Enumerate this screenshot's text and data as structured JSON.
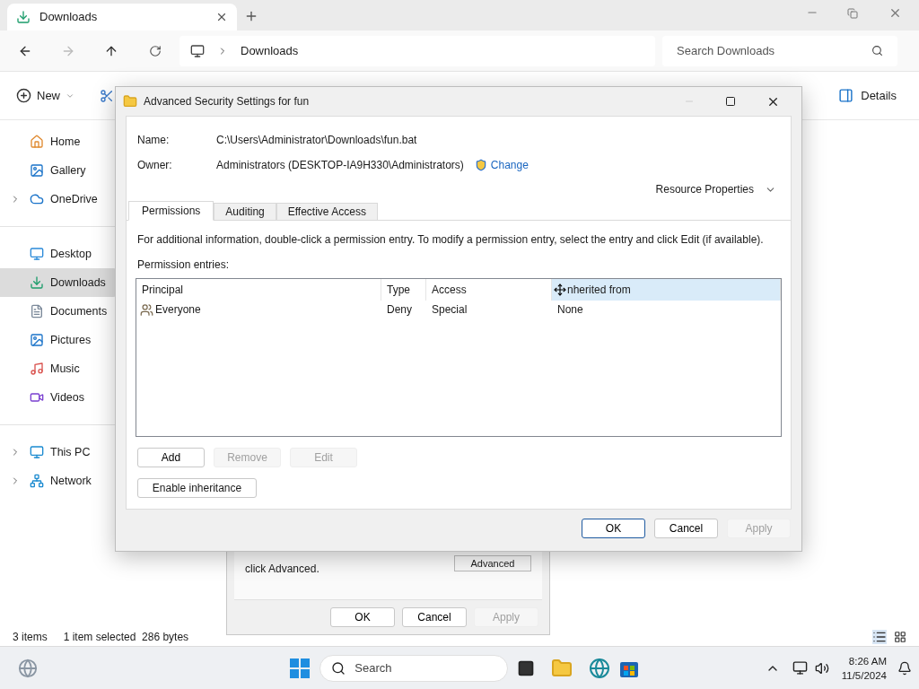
{
  "explorer": {
    "tab_title": "Downloads",
    "path": [
      "Downloads"
    ],
    "search": {
      "placeholder": "Search Downloads"
    },
    "new_label": "New",
    "details_label": "Details",
    "sidebar": [
      [
        {
          "label": "Home",
          "selected": false,
          "expandable": false
        },
        {
          "label": "Gallery",
          "selected": false,
          "expandable": false
        },
        {
          "label": "OneDrive",
          "selected": false,
          "expandable": true
        }
      ],
      [
        {
          "label": "Desktop",
          "selected": false,
          "expandable": false
        },
        {
          "label": "Downloads",
          "selected": true,
          "expandable": false
        },
        {
          "label": "Documents",
          "selected": false,
          "expandable": false
        },
        {
          "label": "Pictures",
          "selected": false,
          "expandable": false
        },
        {
          "label": "Music",
          "selected": false,
          "expandable": false
        },
        {
          "label": "Videos",
          "selected": false,
          "expandable": false
        }
      ],
      [
        {
          "label": "This PC",
          "selected": false,
          "expandable": true
        },
        {
          "label": "Network",
          "selected": false,
          "expandable": true
        }
      ]
    ],
    "status": {
      "count": "3 items",
      "selection": "1 item selected  286 bytes"
    }
  },
  "properties_dialog": {
    "text": "click Advanced.",
    "advanced_label": "Advanced",
    "buttons": [
      {
        "label": "OK",
        "disabled": false
      },
      {
        "label": "Cancel",
        "disabled": false
      },
      {
        "label": "Apply",
        "disabled": true
      }
    ]
  },
  "dialog": {
    "title": "Advanced Security Settings for fun",
    "name_label": "Name:",
    "name_value": "C:\\Users\\Administrator\\Downloads\\fun.bat",
    "owner_label": "Owner:",
    "owner_value": "Administrators (DESKTOP-IA9H330\\Administrators)",
    "change_label": "Change",
    "resource_properties": "Resource Properties",
    "tabs": [
      {
        "label": "Permissions",
        "selected": true
      },
      {
        "label": "Auditing",
        "selected": false
      },
      {
        "label": "Effective Access",
        "selected": false
      }
    ],
    "info": "For additional information, double-click a permission entry. To modify a permission entry, select the entry and click Edit (if available).",
    "entries_label": "Permission entries:",
    "columns": [
      {
        "label": "Principal",
        "hovered": false
      },
      {
        "label": "Type",
        "hovered": false
      },
      {
        "label": "Access",
        "hovered": false
      },
      {
        "label": "nherited from",
        "hovered": true
      }
    ],
    "rows": [
      [
        "Everyone",
        "Deny",
        "Special",
        "None"
      ]
    ],
    "entry_buttons": [
      {
        "label": "Add",
        "disabled": false
      },
      {
        "label": "Remove",
        "disabled": true
      },
      {
        "label": "Edit",
        "disabled": true
      }
    ],
    "inheritance_label": "Enable inheritance",
    "buttons": [
      {
        "label": "OK",
        "disabled": false,
        "default": true
      },
      {
        "label": "Cancel",
        "disabled": false,
        "default": false
      },
      {
        "label": "Apply",
        "disabled": true,
        "default": false
      }
    ]
  },
  "taskbar": {
    "search": {
      "placeholder": "Search"
    },
    "time": "8:26 AM",
    "date": "11/5/2024"
  }
}
